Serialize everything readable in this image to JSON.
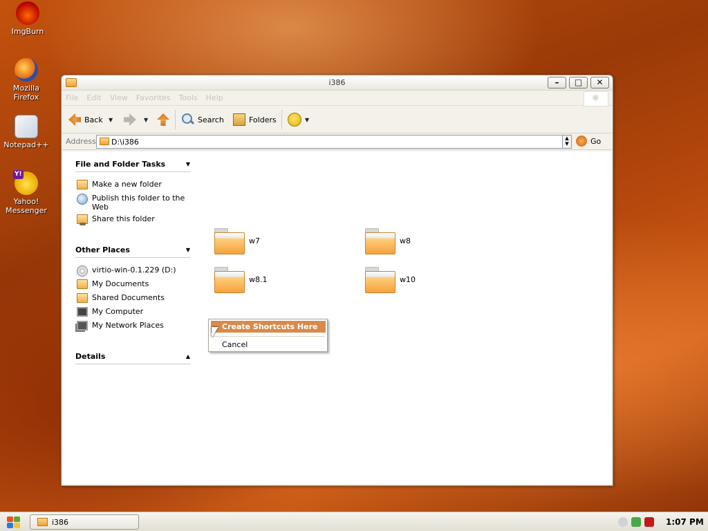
{
  "desktop": {
    "icons": [
      {
        "label": "ImgBurn",
        "icon": "imgburn-icon"
      },
      {
        "label": "Mozilla Firefox",
        "icon": "firefox-icon"
      },
      {
        "label": "Notepad++",
        "icon": "notepad-icon"
      },
      {
        "label": "Yahoo! Messenger",
        "icon": "yahoo-messenger-icon"
      }
    ]
  },
  "window": {
    "title": "i386",
    "menu": [
      "File",
      "Edit",
      "View",
      "Favorites",
      "Tools",
      "Help"
    ],
    "toolbar": {
      "back": "Back",
      "search": "Search",
      "folders": "Folders"
    },
    "address": {
      "label": "Address",
      "value": "D:\\i386",
      "go": "Go"
    },
    "sidebar": {
      "file_tasks": {
        "title": "File and Folder Tasks",
        "items": [
          "Make a new folder",
          "Publish this folder to the Web",
          "Share this folder"
        ]
      },
      "other_places": {
        "title": "Other Places",
        "items": [
          "virtio-win-0.1.229 (D:)",
          "My Documents",
          "Shared Documents",
          "My Computer",
          "My Network Places"
        ]
      },
      "details": {
        "title": "Details"
      }
    },
    "folders": [
      "w7",
      "w8",
      "w8.1",
      "w10"
    ],
    "context_menu": {
      "items": [
        "Create Shortcuts Here",
        "Cancel"
      ]
    }
  },
  "taskbar": {
    "task_label": "i386",
    "clock": "1:07 PM"
  },
  "colors": {
    "menu_highlight": "#d88a4a",
    "folder_orange": "#f5a23e"
  }
}
